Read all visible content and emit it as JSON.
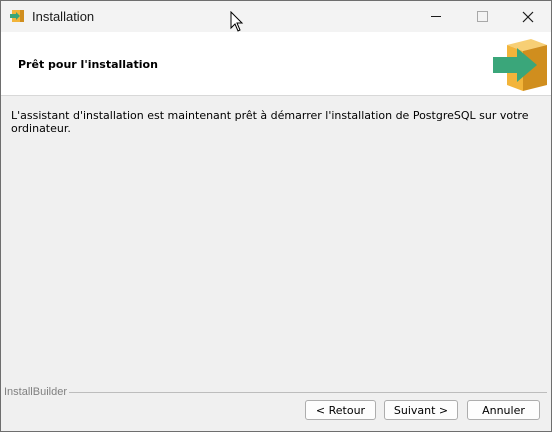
{
  "window": {
    "title": "Installation",
    "controls": [
      "minimize-icon",
      "maximize-icon",
      "close-icon"
    ]
  },
  "header": {
    "title": "Prêt pour l'installation",
    "logo_icon": "box-arrow-icon"
  },
  "main": {
    "message": "L'assistant d'installation est maintenant prêt à démarrer l'installation de PostgreSQL sur votre ordinateur."
  },
  "footer": {
    "builder_label": "InstallBuilder",
    "back_label": "< Retour",
    "next_label": "Suivant >",
    "cancel_label": "Annuler"
  },
  "colors": {
    "box": "#f2b43a",
    "box_dark": "#d08e1e",
    "arrow": "#3aa67a",
    "desktop": "#8a1f1f"
  }
}
